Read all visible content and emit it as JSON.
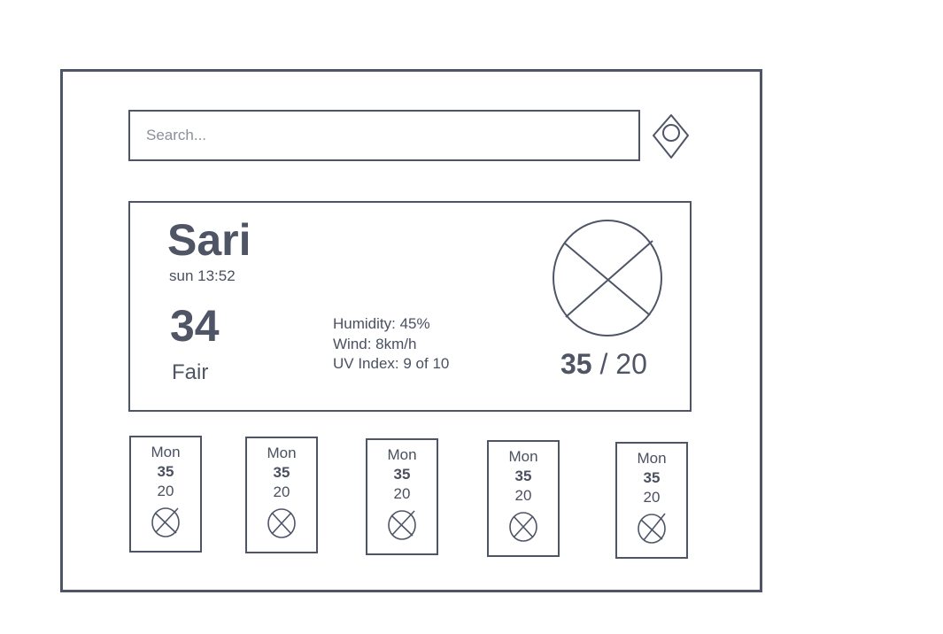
{
  "search": {
    "placeholder": "Search..."
  },
  "current": {
    "city": "Sari",
    "datetime": "sun 13:52",
    "temperature": "34",
    "condition": "Fair",
    "humidity": "Humidity: 45%",
    "wind": "Wind: 8km/h",
    "uv": "UV Index: 9 of 10",
    "high": "35",
    "separator": "/",
    "low": "20",
    "icon": "weather-placeholder-icon"
  },
  "forecast": [
    {
      "day": "Mon",
      "high": "35",
      "low": "20",
      "icon": "weather-placeholder-icon"
    },
    {
      "day": "Mon",
      "high": "35",
      "low": "20",
      "icon": "weather-placeholder-icon"
    },
    {
      "day": "Mon",
      "high": "35",
      "low": "20",
      "icon": "weather-placeholder-icon"
    },
    {
      "day": "Mon",
      "high": "35",
      "low": "20",
      "icon": "weather-placeholder-icon"
    },
    {
      "day": "Mon",
      "high": "35",
      "low": "20",
      "icon": "weather-placeholder-icon"
    }
  ],
  "colors": {
    "stroke": "#4e5566",
    "text": "#4a5060"
  }
}
